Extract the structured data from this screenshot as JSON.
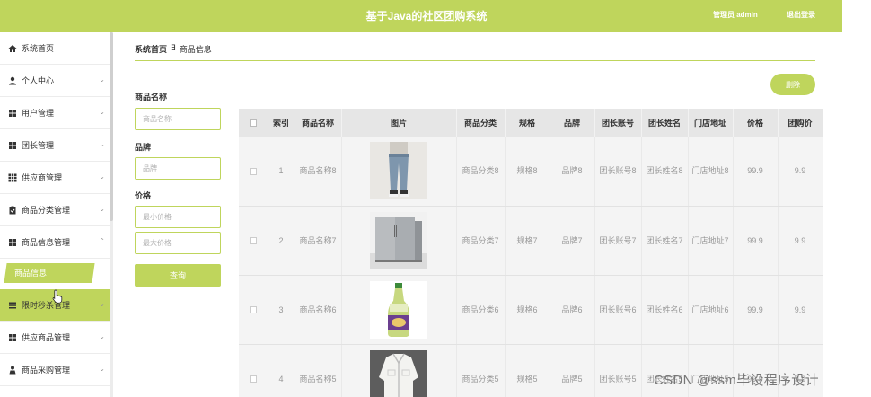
{
  "header": {
    "title": "基于Java的社区团购系统",
    "user_label": "管理员 admin",
    "logout_label": "退出登录"
  },
  "sidebar": {
    "items": [
      {
        "label": "系统首页",
        "icon": "home-icon",
        "chevron": ""
      },
      {
        "label": "个人中心",
        "icon": "user-icon",
        "chevron": "⌄"
      },
      {
        "label": "用户管理",
        "icon": "grid-icon",
        "chevron": "⌄"
      },
      {
        "label": "团长管理",
        "icon": "grid-icon",
        "chevron": "⌄"
      },
      {
        "label": "供应商管理",
        "icon": "grid9-icon",
        "chevron": "⌄"
      },
      {
        "label": "商品分类管理",
        "icon": "clipboard-icon",
        "chevron": "⌄"
      },
      {
        "label": "商品信息管理",
        "icon": "grid-icon",
        "chevron": "⌃"
      },
      {
        "label": "限时秒杀管理",
        "icon": "list-icon",
        "chevron": "⌄"
      },
      {
        "label": "供应商品管理",
        "icon": "grid-icon",
        "chevron": "⌄"
      },
      {
        "label": "商品采购管理",
        "icon": "person-icon",
        "chevron": "⌄"
      }
    ],
    "active_sub": "商品信息"
  },
  "breadcrumb": {
    "home": "系统首页",
    "sep": "∃",
    "current": "商品信息"
  },
  "filters": {
    "name_label": "商品名称",
    "name_placeholder": "商品名称",
    "brand_label": "品牌",
    "brand_placeholder": "品牌",
    "price_label": "价格",
    "min_placeholder": "最小价格",
    "max_placeholder": "最大价格",
    "search_label": "查询"
  },
  "actions": {
    "delete_label": "删除"
  },
  "table": {
    "headers": [
      "",
      "索引",
      "商品名称",
      "图片",
      "商品分类",
      "规格",
      "品牌",
      "团长账号",
      "团长姓名",
      "门店地址",
      "价格",
      "团购价"
    ],
    "rows": [
      {
        "index": "1",
        "name": "商品名称8",
        "image": "jeans",
        "category": "商品分类8",
        "spec": "规格8",
        "brand": "品牌8",
        "leader_account": "团长账号8",
        "leader_name": "团长姓名8",
        "address": "门店地址8",
        "price": "99.9",
        "group_price": "9.9"
      },
      {
        "index": "2",
        "name": "商品名称7",
        "image": "fridge",
        "category": "商品分类7",
        "spec": "规格7",
        "brand": "品牌7",
        "leader_account": "团长账号7",
        "leader_name": "团长姓名7",
        "address": "门店地址7",
        "price": "99.9",
        "group_price": "9.9"
      },
      {
        "index": "3",
        "name": "商品名称6",
        "image": "bottle",
        "category": "商品分类6",
        "spec": "规格6",
        "brand": "品牌6",
        "leader_account": "团长账号6",
        "leader_name": "团长姓名6",
        "address": "门店地址6",
        "price": "99.9",
        "group_price": "9.9"
      },
      {
        "index": "4",
        "name": "商品名称5",
        "image": "jacket",
        "category": "商品分类5",
        "spec": "规格5",
        "brand": "品牌5",
        "leader_account": "团长账号5",
        "leader_name": "团长姓名5",
        "address": "门店地址5",
        "price": "99.9",
        "group_price": "9.9"
      }
    ]
  },
  "watermark": "CSDN @ssm毕设程序设计",
  "colors": {
    "accent": "#bfd55c"
  }
}
